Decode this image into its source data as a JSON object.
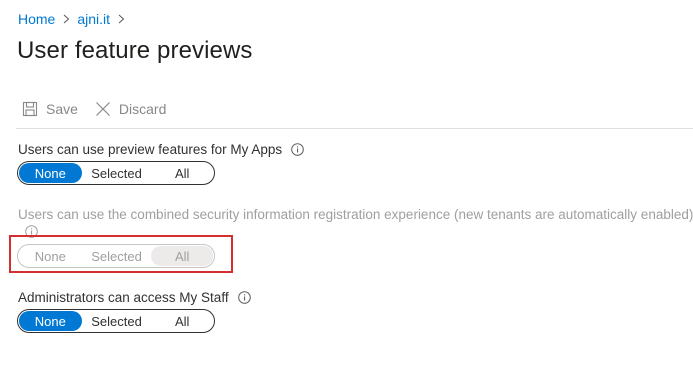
{
  "breadcrumb": {
    "home": "Home",
    "tenant": "ajni.it",
    "separator": ">"
  },
  "page": {
    "title": "User feature previews"
  },
  "toolbar": {
    "save_label": "Save",
    "discard_label": "Discard"
  },
  "settings": [
    {
      "label": "Users can use preview features for My Apps",
      "options": [
        "None",
        "Selected",
        "All"
      ],
      "selected": "None",
      "disabled": false
    },
    {
      "label": "Users can use the combined security information registration experience (new tenants are automatically enabled)",
      "options": [
        "None",
        "Selected",
        "All"
      ],
      "selected": "All",
      "disabled": true
    },
    {
      "label": "Administrators can access My Staff",
      "options": [
        "None",
        "Selected",
        "All"
      ],
      "selected": "None",
      "disabled": false
    }
  ],
  "icons": {
    "save": "save-icon",
    "discard": "close-icon",
    "info": "info-icon"
  },
  "colors": {
    "accent": "#0078d4",
    "highlight": "#d32f2f",
    "disabled_text": "#a19f9d"
  }
}
